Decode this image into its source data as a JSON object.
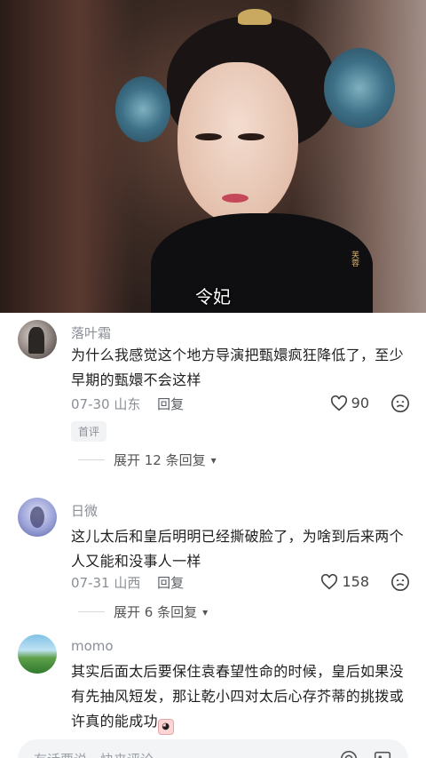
{
  "video": {
    "subtitle": "令妃",
    "seal_text": "芙蓉"
  },
  "comments": [
    {
      "username": "落叶霜",
      "text": "为什么我感觉这个地方导演把甄嬛疯狂降低了，至少早期的甄嬛不会这样",
      "date": "07-30",
      "location": "山东",
      "reply_label": "回复",
      "likes": "90",
      "badge": "首评",
      "expand_label": "展开 12 条回复"
    },
    {
      "username": "日微",
      "text": "这儿太后和皇后明明已经撕破脸了，为啥到后来两个人又能和没事人一样",
      "date": "07-31",
      "location": "山西",
      "reply_label": "回复",
      "likes": "158",
      "expand_label": "展开 6 条回复"
    },
    {
      "username": "momo",
      "text": "其实后面太后要保住袁春望性命的时候，皇后如果没有先抽风短发，那让乾小四对太后心存芥蒂的挑拨或许真的能成功"
    }
  ],
  "input_bar": {
    "placeholder": "有话要说，快来评论"
  },
  "icons": {
    "like": "heart-outline-icon",
    "dislike": "frown-face-icon",
    "emoji_inline": "crying-face-emoji",
    "mention": "at-sign-icon",
    "image": "image-icon"
  },
  "colors": {
    "meta_gray": "#8a8f96",
    "text_dark": "#1f1f1f"
  }
}
